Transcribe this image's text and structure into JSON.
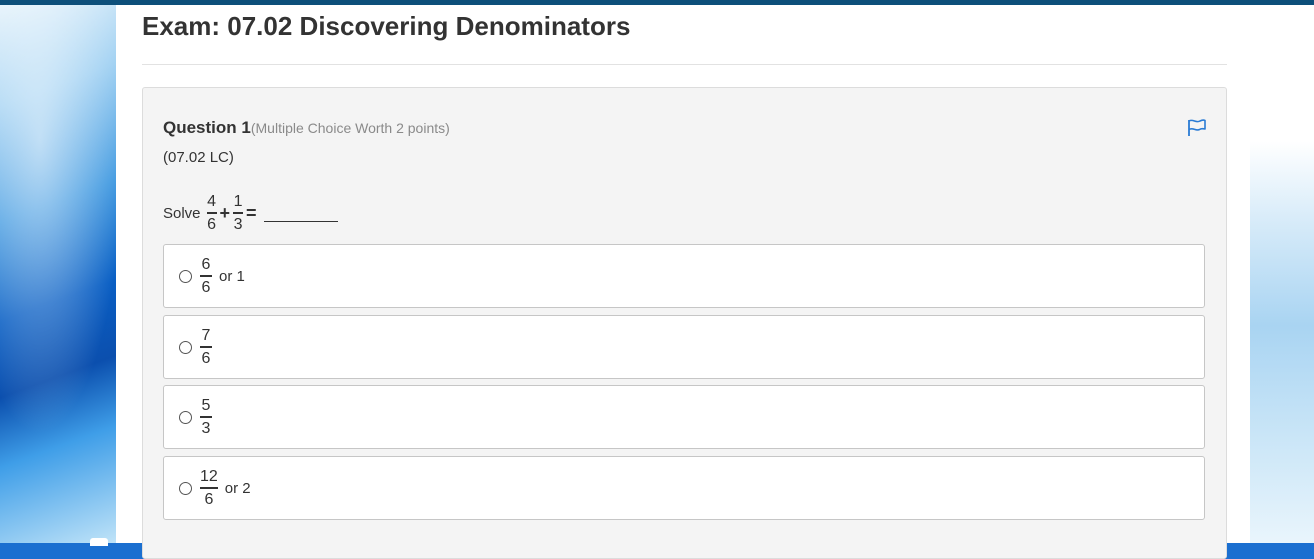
{
  "exam": {
    "title": "Exam: 07.02 Discovering Denominators"
  },
  "question": {
    "number_label": "Question 1",
    "meta": "(Multiple Choice Worth 2 points)",
    "code": "(07.02 LC)",
    "flag_icon": "flag-icon",
    "prompt": {
      "word": "Solve",
      "term1": {
        "numerator": "4",
        "denominator": "6"
      },
      "operator": "+",
      "term2": {
        "numerator": "1",
        "denominator": "3"
      },
      "equals": "="
    },
    "choices": [
      {
        "numerator": "6",
        "denominator": "6",
        "suffix": "or 1"
      },
      {
        "numerator": "7",
        "denominator": "6",
        "suffix": ""
      },
      {
        "numerator": "5",
        "denominator": "3",
        "suffix": ""
      },
      {
        "numerator": "12",
        "denominator": "6",
        "suffix": "or 2"
      }
    ]
  },
  "colors": {
    "top_bar": "#0d4f7a",
    "flag": "#2a7bd4",
    "panel_bg": "#f4f4f4"
  }
}
